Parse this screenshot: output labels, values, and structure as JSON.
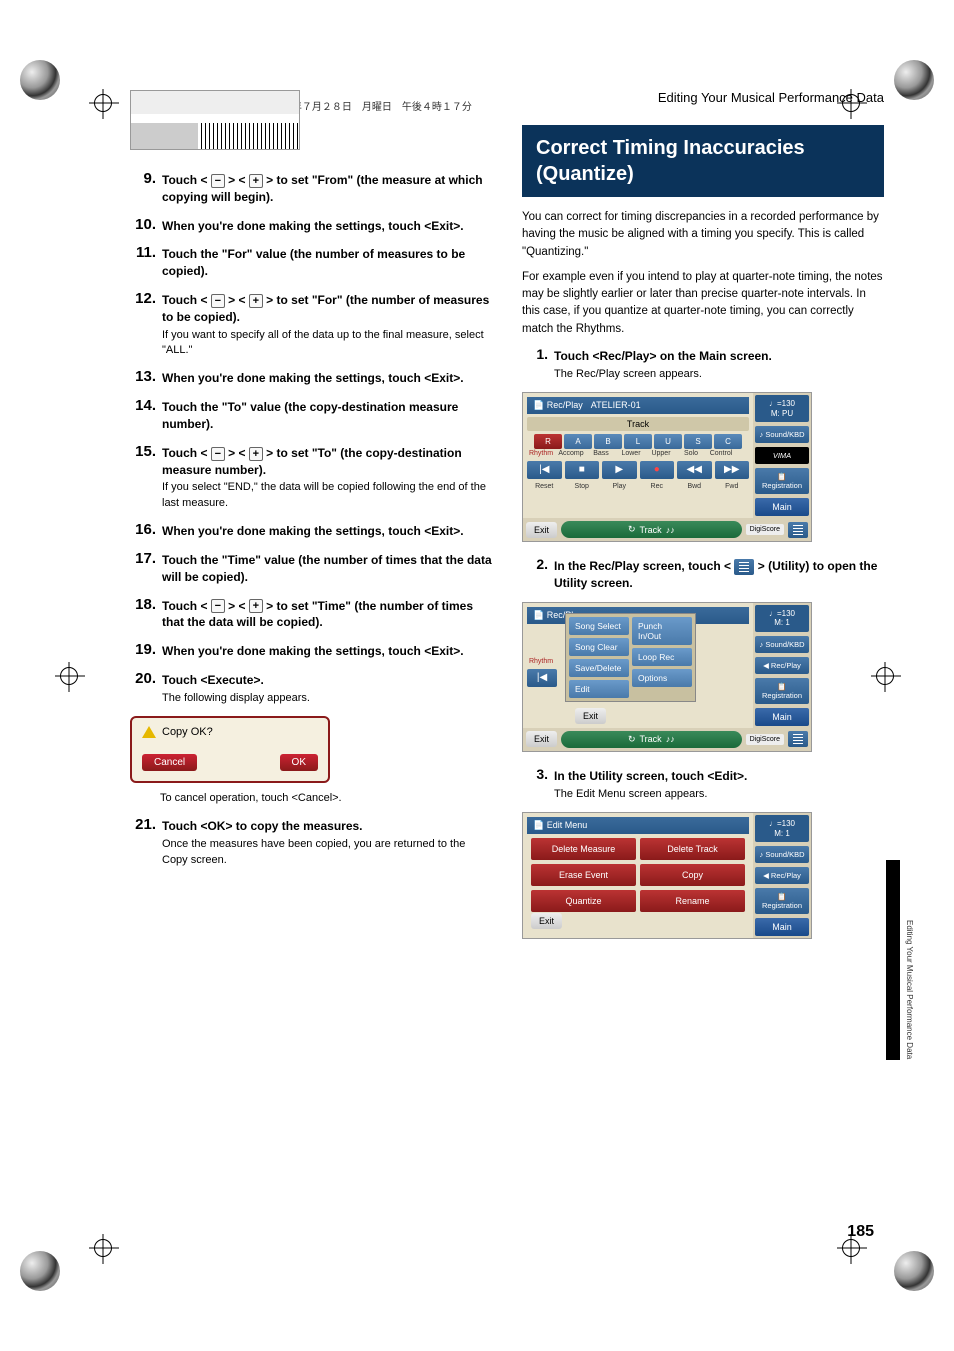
{
  "header": "AT-500_e.book  185 ページ  ２００８年７月２８日　月曜日　午後４時１７分",
  "right_header": "Editing Your Musical Performance Data",
  "side_tab_text": "Editing Your Musical Performance Data",
  "page_number": "185",
  "left": {
    "steps": [
      {
        "n": "9.",
        "title_a": "Touch < ",
        "title_b": " > < ",
        "title_c": " > to set \"From\" (the measure at which copying will begin).",
        "note": ""
      },
      {
        "n": "10.",
        "title": "When you're done making the settings, touch <Exit>.",
        "note": ""
      },
      {
        "n": "11.",
        "title": "Touch the \"For\" value (the number of measures to be copied).",
        "note": ""
      },
      {
        "n": "12.",
        "title_a": "Touch < ",
        "title_b": " > < ",
        "title_c": " > to set \"For\" (the number of measures to be copied).",
        "note": "If you want to specify all of the data up to the final measure, select \"ALL.\""
      },
      {
        "n": "13.",
        "title": "When you're done making the settings, touch <Exit>.",
        "note": ""
      },
      {
        "n": "14.",
        "title": "Touch the \"To\" value (the copy-destination measure number).",
        "note": ""
      },
      {
        "n": "15.",
        "title_a": "Touch < ",
        "title_b": " > < ",
        "title_c": " > to set \"To\" (the copy-destination measure number).",
        "note": "If you select \"END,\" the data will be copied following the end of the last measure."
      },
      {
        "n": "16.",
        "title": "When you're done making the settings, touch <Exit>.",
        "note": ""
      },
      {
        "n": "17.",
        "title": "Touch the \"Time\" value (the number of times that the data will be copied).",
        "note": ""
      },
      {
        "n": "18.",
        "title_a": "Touch < ",
        "title_b": " > < ",
        "title_c": " > to set \"Time\" (the number of times that the data will be copied).",
        "note": ""
      },
      {
        "n": "19.",
        "title": "When you're done making the settings, touch <Exit>.",
        "note": ""
      },
      {
        "n": "20.",
        "title": "Touch <Execute>.",
        "note": "The following display appears."
      }
    ],
    "dialog": {
      "message": "Copy OK?",
      "cancel": "Cancel",
      "ok": "OK"
    },
    "cancel_note": "To cancel operation, touch <Cancel>.",
    "step21": {
      "n": "21.",
      "title": "Touch <OK> to copy the measures.",
      "note": "Once the measures have been copied, you are returned to the Copy screen."
    }
  },
  "right": {
    "section_title": "Correct Timing Inaccuracies (Quantize)",
    "p1": "You can correct for timing discrepancies in a recorded performance by having the music be aligned with a timing you specify. This is called \"Quantizing.\"",
    "p2": "For example even if you intend to play at quarter-note timing, the notes may be slightly earlier or later than precise quarter-note intervals. In this case, if you quantize at quarter-note timing, you can correctly match the Rhythms.",
    "steps": {
      "s1": {
        "n": "1.",
        "title": "Touch <Rec/Play> on the Main screen.",
        "note": "The Rec/Play screen appears."
      },
      "s2": {
        "n": "2.",
        "title_a": "In the Rec/Play screen, touch < ",
        "title_b": " > (Utility) to open the Utility screen."
      },
      "s3": {
        "n": "3.",
        "title": "In the Utility screen, touch <Edit>.",
        "note": "The Edit Menu screen appears."
      }
    },
    "recplay": {
      "title": "Rec/Play",
      "song": "ATELIER-01",
      "track": "Track",
      "tracks": [
        "R",
        "A",
        "B",
        "L",
        "U",
        "S",
        "C"
      ],
      "track_labels": [
        "Rhythm",
        "Accomp",
        "Bass",
        "Lower",
        "Upper",
        "Solo",
        "Control"
      ],
      "transport_labels": [
        "Reset",
        "Stop",
        "Play",
        "Rec",
        "Bwd",
        "Fwd"
      ],
      "exit": "Exit",
      "trackpill": "Track",
      "digiscore": "DigiScore",
      "tempo": "♩=130",
      "measure": "M:  PU",
      "side": [
        "Sound/KBD",
        "VIMA",
        "Registration",
        "Main"
      ]
    },
    "util": {
      "title": "Rec/Pl",
      "left_col": [
        "Song Select",
        "Song Clear",
        "Save/Delete",
        "Edit"
      ],
      "right_col": [
        "Punch In/Out",
        "Loop Rec",
        "Options"
      ],
      "exit_inner": "Exit",
      "exit": "Exit",
      "trackpill": "Track",
      "digiscore": "DigiScore",
      "tempo": "♩=130",
      "measure": "M:    1",
      "side": [
        "Sound/KBD",
        "Rec/Play",
        "Registration",
        "Main"
      ]
    },
    "edit": {
      "title": "Edit Menu",
      "rows": [
        [
          "Delete Measure",
          "Delete Track"
        ],
        [
          "Erase Event",
          "Copy"
        ],
        [
          "Quantize",
          "Rename"
        ]
      ],
      "exit": "Exit",
      "tempo": "♩=130",
      "measure": "M:    1",
      "side": [
        "Sound/KBD",
        "Rec/Play",
        "Registration",
        "Main"
      ]
    }
  }
}
